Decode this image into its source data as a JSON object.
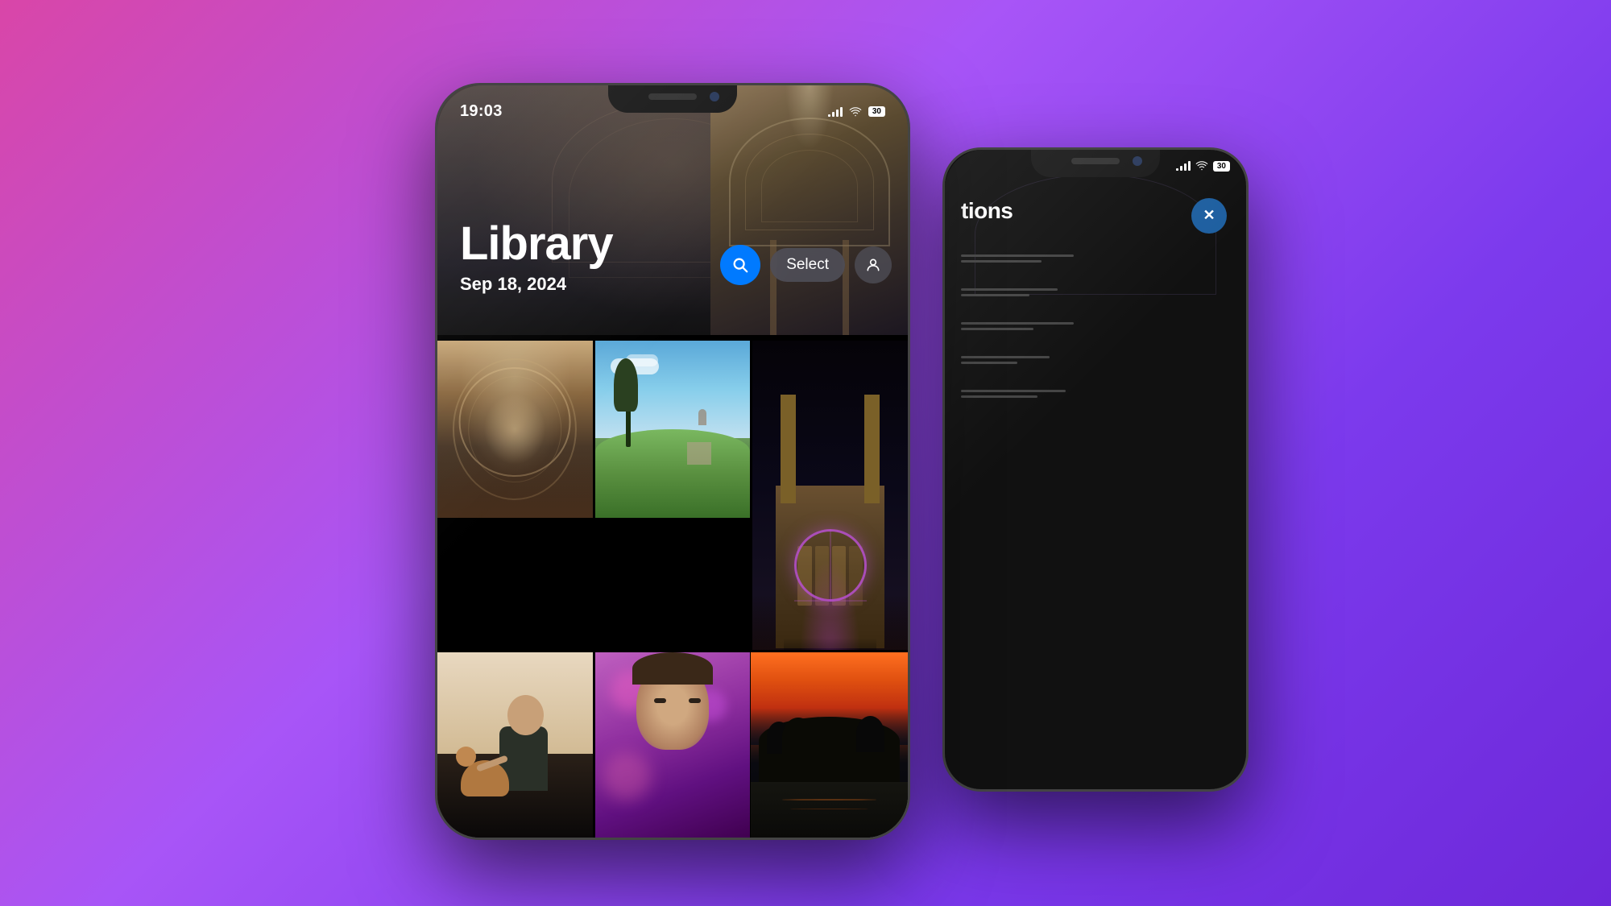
{
  "background": {
    "gradient": "linear-gradient(135deg, #d946a8 0%, #a855f7 40%, #7c3aed 70%, #6d28d9 100%)"
  },
  "phone1": {
    "status_bar": {
      "time": "19:03",
      "signal": "signal-icon",
      "wifi": "wifi-icon",
      "battery": "30"
    },
    "header": {
      "title": "Library",
      "date": "Sep 18, 2024",
      "search_btn_label": "Search",
      "select_btn_label": "Select",
      "person_btn_label": "Person"
    },
    "photos": [
      {
        "id": "ceiling",
        "description": "Ornate church ceiling"
      },
      {
        "id": "countryside",
        "description": "Countryside church on hill"
      },
      {
        "id": "battersea",
        "description": "Battersea power station with ferris wheel"
      },
      {
        "id": "person-dog",
        "description": "Person sitting with dog"
      },
      {
        "id": "face",
        "description": "Person face with pink light"
      },
      {
        "id": "lake-sunset",
        "description": "Tree silhouette reflected in lake at sunset"
      }
    ]
  },
  "phone2": {
    "status_bar": {
      "signal": "signal-icon",
      "wifi": "wifi-icon",
      "battery": "30"
    },
    "header": {
      "title": "tions",
      "close_btn_label": "Close"
    },
    "list_items": [
      {
        "lines": [
          140,
          100
        ]
      },
      {
        "lines": [
          120,
          80
        ]
      },
      {
        "lines": [
          140,
          90
        ]
      },
      {
        "lines": [
          110,
          70
        ]
      },
      {
        "lines": [
          130,
          85
        ]
      }
    ]
  }
}
